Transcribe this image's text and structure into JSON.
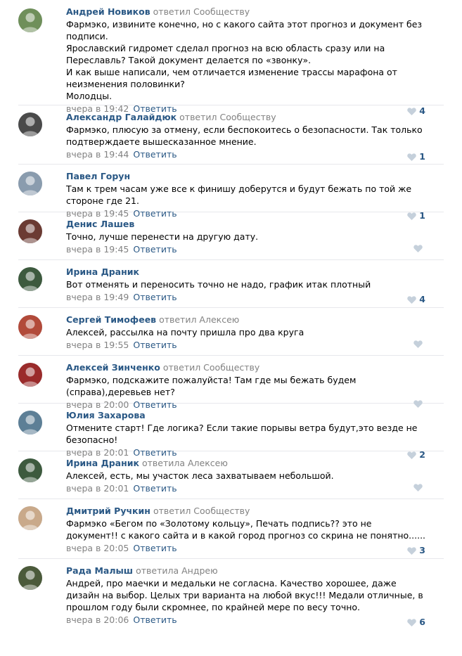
{
  "colors": {
    "link": "#2a5885",
    "muted": "#828282",
    "divider": "#e7e8ec",
    "heart": "#c5d0db"
  },
  "comments": [
    {
      "author": "Андрей Новиков",
      "replied": "ответил Сообществу",
      "text": "Фармэко, извините конечно, но с какого сайта этот прогноз и документ без подписи.\nЯрославский гидромет сделал прогноз на всю область сразу или на Переславль? Такой документ делается по «звонку».\nИ как выше написали, чем отличается изменение трассы марафона от неизменения половинки?\nМолодцы.",
      "time": "вчера в 19:42",
      "reply": "Ответить",
      "likes": "4",
      "avatar_color": "#6f8f5a"
    },
    {
      "author": "Александр Галайдюк",
      "replied": "ответил Сообществу",
      "text": "Фармэко, плюсую за отмену, если беспокоитесь о безопасности. Так только подтверждаете вышесказанное мнение.",
      "time": "вчера в 19:44",
      "reply": "Ответить",
      "likes": "1",
      "avatar_color": "#4a4a4a"
    },
    {
      "author": "Павел Горун",
      "replied": "",
      "text": "Там к трем часам уже все к финишу доберутся и будут бежать по той же стороне где 21.",
      "time": "вчера в 19:45",
      "reply": "Ответить",
      "likes": "1",
      "avatar_color": "#8a9cae"
    },
    {
      "author": "Денис Лашев",
      "replied": "",
      "text": "Точно, лучше перенести на другую дату.",
      "time": "вчера в 19:45",
      "reply": "Ответить",
      "likes": "",
      "avatar_color": "#6b3b33"
    },
    {
      "author": "Ирина Драник",
      "replied": "",
      "text": "Вот отменять и переносить точно не надо, график итак плотный",
      "time": "вчера в 19:49",
      "reply": "Ответить",
      "likes": "4",
      "avatar_color": "#3d5a3e"
    },
    {
      "author": "Сергей Тимофеев",
      "replied": "ответил Алексею",
      "text": "Алексей, рассылка на почту пришла про два круга",
      "time": "вчера в 19:55",
      "reply": "Ответить",
      "likes": "",
      "avatar_color": "#b24a3a"
    },
    {
      "author": "Алексей Зинченко",
      "replied": "ответил Сообществу",
      "text": "Фармэко, подскажите пожалуйста! Там где мы бежать будем (справа),деревьев нет?",
      "time": "вчера в 20:00",
      "reply": "Ответить",
      "likes": "",
      "avatar_color": "#9a2b2b"
    },
    {
      "author": "Юлия Захарова",
      "replied": "",
      "text": "Отмените старт! Где логика? Если такие порывы ветра будут,это везде не безопасно!",
      "time": "вчера в 20:01",
      "reply": "Ответить",
      "likes": "2",
      "avatar_color": "#5d7f96"
    },
    {
      "author": "Ирина Драник",
      "replied": "ответила Алексею",
      "text": "Алексей, есть, мы участок леса захватываем небольшой.",
      "time": "вчера в 20:01",
      "reply": "Ответить",
      "likes": "",
      "avatar_color": "#3d5a3e"
    },
    {
      "author": "Дмитрий Ручкин",
      "replied": "ответил Сообществу",
      "text": "Фармэко «Бегом по «Золотому кольцу», Печать подпись?? это не документ!! с какого сайта и в какой город прогноз со скрина не понятно......",
      "time": "вчера в 20:05",
      "reply": "Ответить",
      "likes": "3",
      "avatar_color": "#c9a98a"
    },
    {
      "author": "Рада Малыш",
      "replied": "ответила Андрею",
      "text": "Андрей, про маечки и медальки не согласна. Качество хорошее, даже дизайн на выбор. Целых три варианта на любой вкус!!! Медали отличные, в прошлом году были скромнее, по крайней мере по весу точно.",
      "time": "вчера в 20:06",
      "reply": "Ответить",
      "likes": "6",
      "avatar_color": "#4b5a3a"
    }
  ]
}
